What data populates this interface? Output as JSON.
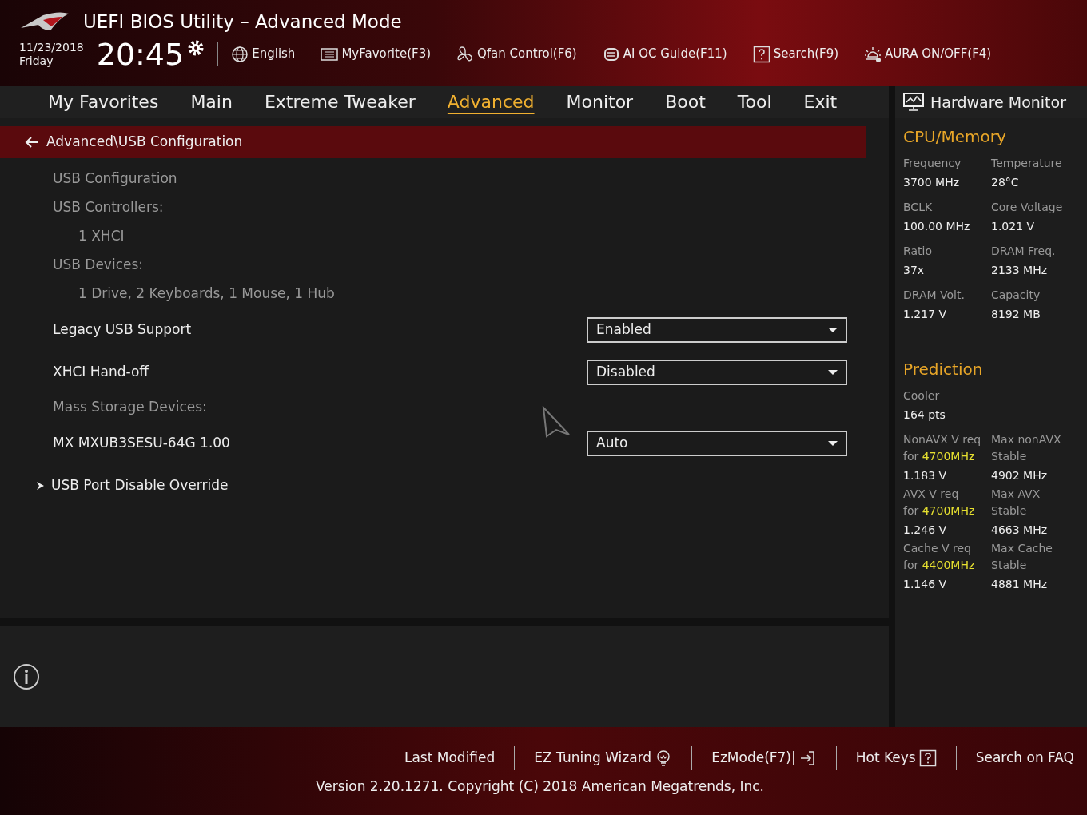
{
  "header": {
    "title": "UEFI BIOS Utility – Advanced Mode",
    "date": "11/23/2018",
    "day": "Friday",
    "time": "20:45",
    "tools": [
      {
        "kind": "globe",
        "label": "English"
      },
      {
        "kind": "favorite",
        "label": "MyFavorite(F3)"
      },
      {
        "kind": "fan",
        "label": "Qfan Control(F6)"
      },
      {
        "kind": "chip",
        "label": "AI OC Guide(F11)"
      },
      {
        "kind": "question",
        "label": "Search(F9)"
      },
      {
        "kind": "light",
        "label": "AURA ON/OFF(F4)"
      }
    ]
  },
  "tabs": [
    {
      "label": "My Favorites",
      "selected": false
    },
    {
      "label": "Main",
      "selected": false
    },
    {
      "label": "Extreme Tweaker",
      "selected": false
    },
    {
      "label": "Advanced",
      "selected": true
    },
    {
      "label": "Monitor",
      "selected": false
    },
    {
      "label": "Boot",
      "selected": false
    },
    {
      "label": "Tool",
      "selected": false
    },
    {
      "label": "Exit",
      "selected": false
    }
  ],
  "breadcrumb": "Advanced\\USB Configuration",
  "settings": [
    {
      "kind": "heading",
      "label": "USB Configuration"
    },
    {
      "kind": "heading",
      "label": "USB Controllers:"
    },
    {
      "kind": "info",
      "label": "1 XHCI"
    },
    {
      "kind": "heading",
      "label": "USB Devices:"
    },
    {
      "kind": "info",
      "label": "1 Drive, 2 Keyboards, 1 Mouse, 1 Hub"
    },
    {
      "kind": "option",
      "label": "Legacy USB Support",
      "value": "Enabled"
    },
    {
      "kind": "option",
      "label": "XHCI Hand-off",
      "value": "Disabled"
    },
    {
      "kind": "heading",
      "label": "Mass Storage Devices:"
    },
    {
      "kind": "option",
      "label": "MX MXUB3SESU-64G 1.00",
      "value": "Auto"
    },
    {
      "kind": "submenu",
      "label": "USB Port Disable Override"
    }
  ],
  "hardware_monitor": {
    "title": "Hardware Monitor",
    "cpu_memory": {
      "title": "CPU/Memory",
      "stats": [
        {
          "label": "Frequency",
          "value": "3700 MHz"
        },
        {
          "label": "Temperature",
          "value": "28°C"
        },
        {
          "label": "BCLK",
          "value": "100.00 MHz"
        },
        {
          "label": "Core Voltage",
          "value": "1.021 V"
        },
        {
          "label": "Ratio",
          "value": "37x"
        },
        {
          "label": "DRAM Freq.",
          "value": "2133 MHz"
        },
        {
          "label": "DRAM Volt.",
          "value": "1.217 V"
        },
        {
          "label": "Capacity",
          "value": "8192 MB"
        }
      ]
    },
    "prediction": {
      "title": "Prediction",
      "cooler_label": "Cooler",
      "cooler_value": "164 pts",
      "rows": [
        {
          "label_1": "NonAVX V req",
          "label_2": "for **4700MHz**",
          "value": "1.183 V",
          "max_label_1": "Max nonAVX",
          "max_label_2": "Stable",
          "max_value": "4902 MHz"
        },
        {
          "label_1": "AVX V req",
          "label_2": "for **4700MHz**",
          "value": "1.246 V",
          "max_label_1": "Max AVX",
          "max_label_2": "Stable",
          "max_value": "4663 MHz"
        },
        {
          "label_1": "Cache V req",
          "label_2": "for **4400MHz**",
          "value": "1.146 V",
          "max_label_1": "Max Cache",
          "max_label_2": "Stable",
          "max_value": "4881 MHz"
        }
      ]
    }
  },
  "footer": {
    "items": [
      {
        "kind": "plain",
        "label": "Last Modified"
      },
      {
        "kind": "bulb",
        "label": "EZ Tuning Wizard"
      },
      {
        "kind": "exit",
        "label": "EzMode(F7)|"
      },
      {
        "kind": "question",
        "label": "Hot Keys"
      },
      {
        "kind": "plain",
        "label": "Search on FAQ"
      }
    ],
    "version": "Version 2.20.1271. Copyright (C) 2018 American Megatrends, Inc."
  }
}
